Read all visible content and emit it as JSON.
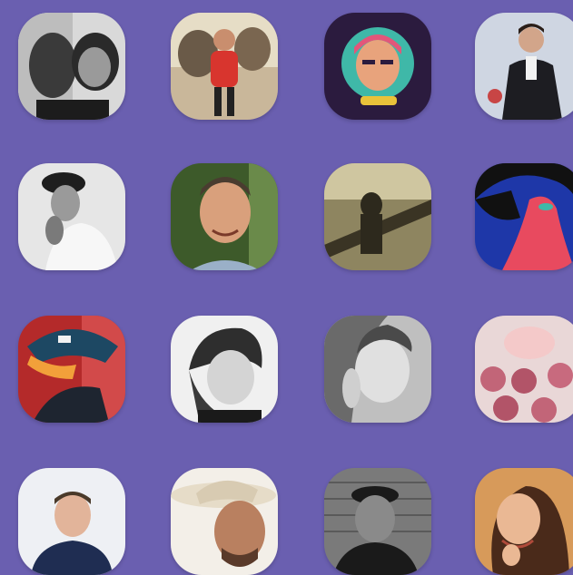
{
  "background_color": "#6a5fb0",
  "avatars": [
    {
      "icon": "avatar-photo",
      "tone": "black-and-white",
      "bg": "#d9d9d9",
      "fg": "#2a2a2a"
    },
    {
      "icon": "avatar-photo",
      "tone": "color",
      "bg": "#c9b79a",
      "fg": "#d8352e"
    },
    {
      "icon": "avatar-illustration",
      "tone": "color",
      "bg": "#2b1b3e",
      "fg": "#e2567a"
    },
    {
      "icon": "avatar-photo",
      "tone": "color",
      "bg": "#cfd6e2",
      "fg": "#1d1d22"
    },
    {
      "icon": "avatar-photo",
      "tone": "black-and-white",
      "bg": "#e6e6e6",
      "fg": "#333333"
    },
    {
      "icon": "avatar-photo",
      "tone": "color",
      "bg": "#3d5a2a",
      "fg": "#d9a07c"
    },
    {
      "icon": "avatar-photo",
      "tone": "sepia",
      "bg": "#8e8560",
      "fg": "#2d291d"
    },
    {
      "icon": "avatar-illustration",
      "tone": "color",
      "bg": "#1e37a8",
      "fg": "#e84a5f"
    },
    {
      "icon": "avatar-photo",
      "tone": "color",
      "bg": "#b42a2a",
      "fg": "#1d4863"
    },
    {
      "icon": "avatar-photo",
      "tone": "black-and-white",
      "bg": "#f0f0f0",
      "fg": "#2e2e2e"
    },
    {
      "icon": "avatar-photo",
      "tone": "black-and-white",
      "bg": "#bfbfbf",
      "fg": "#4a4a4a"
    },
    {
      "icon": "avatar-photo",
      "tone": "color",
      "bg": "#e9d7d7",
      "fg": "#c26578"
    },
    {
      "icon": "avatar-photo",
      "tone": "color",
      "bg": "#eef0f4",
      "fg": "#1f2d52"
    },
    {
      "icon": "avatar-photo",
      "tone": "color",
      "bg": "#f3efe8",
      "fg": "#5a3a2a"
    },
    {
      "icon": "avatar-photo",
      "tone": "black-and-white",
      "bg": "#7a7a7a",
      "fg": "#1a1a1a"
    },
    {
      "icon": "avatar-photo",
      "tone": "color",
      "bg": "#d79a5a",
      "fg": "#4a2a1a"
    }
  ]
}
